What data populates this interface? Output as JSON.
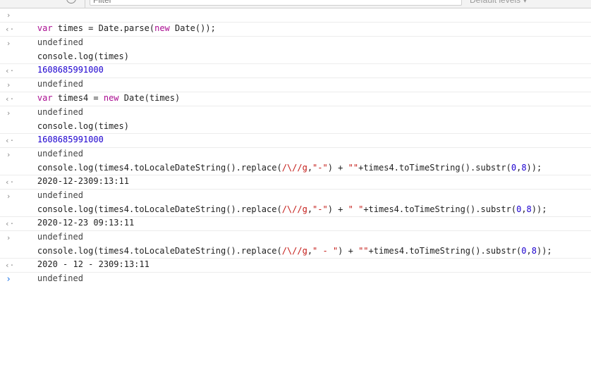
{
  "toolbar": {
    "filter_placeholder": "Filter",
    "levels_label": "Default levels ▾"
  },
  "icons": {
    "input_marker": "›",
    "output_marker": "‹·",
    "prompt_marker": "›"
  },
  "console": {
    "l1": {
      "a": "var",
      "b": " times = Date.parse(",
      "c": "new",
      "d": " Date());"
    },
    "l2": "undefined",
    "l3": "console.log(times)",
    "l4": "1608685991000",
    "l5": "undefined",
    "l6": {
      "a": "var",
      "b": " times4 = ",
      "c": "new",
      "d": " Date(times)"
    },
    "l7": "undefined",
    "l8": "console.log(times)",
    "l9": "1608685991000",
    "l10": "undefined",
    "l11": {
      "a": "console.log(times4.toLocaleDateString().replace(",
      "b": "/\\//g",
      "c": ",",
      "d": "\"-\"",
      "e": ") + ",
      "f": "\"\"",
      "g": "+times4.toTimeString().substr(",
      "h": "0",
      "i": ",",
      "j": "8",
      "k": "));"
    },
    "l12": "2020-12-2309:13:11",
    "l13": "undefined",
    "l14": {
      "a": "console.log(times4.toLocaleDateString().replace(",
      "b": "/\\//g",
      "c": ",",
      "d": "\"-\"",
      "e": ") + ",
      "f": "\" \"",
      "g": "+times4.toTimeString().substr(",
      "h": "0",
      "i": ",",
      "j": "8",
      "k": "));"
    },
    "l15": "2020-12-23 09:13:11",
    "l16": "undefined",
    "l17": {
      "a": "console.log(times4.toLocaleDateString().replace(",
      "b": "/\\//g",
      "c": ",",
      "d": "\" - \"",
      "e": ") + ",
      "f": "\"\"",
      "g": "+times4.toTimeString().substr(",
      "h": "0",
      "i": ",",
      "j": "8",
      "k": "));"
    },
    "l18": "2020 - 12 - 2309:13:11",
    "l19": "undefined"
  },
  "colors": {
    "keyword": "#aa0d91",
    "string": "#c41a16",
    "number": "#1c00cf",
    "prompt": "#1a73e8"
  }
}
